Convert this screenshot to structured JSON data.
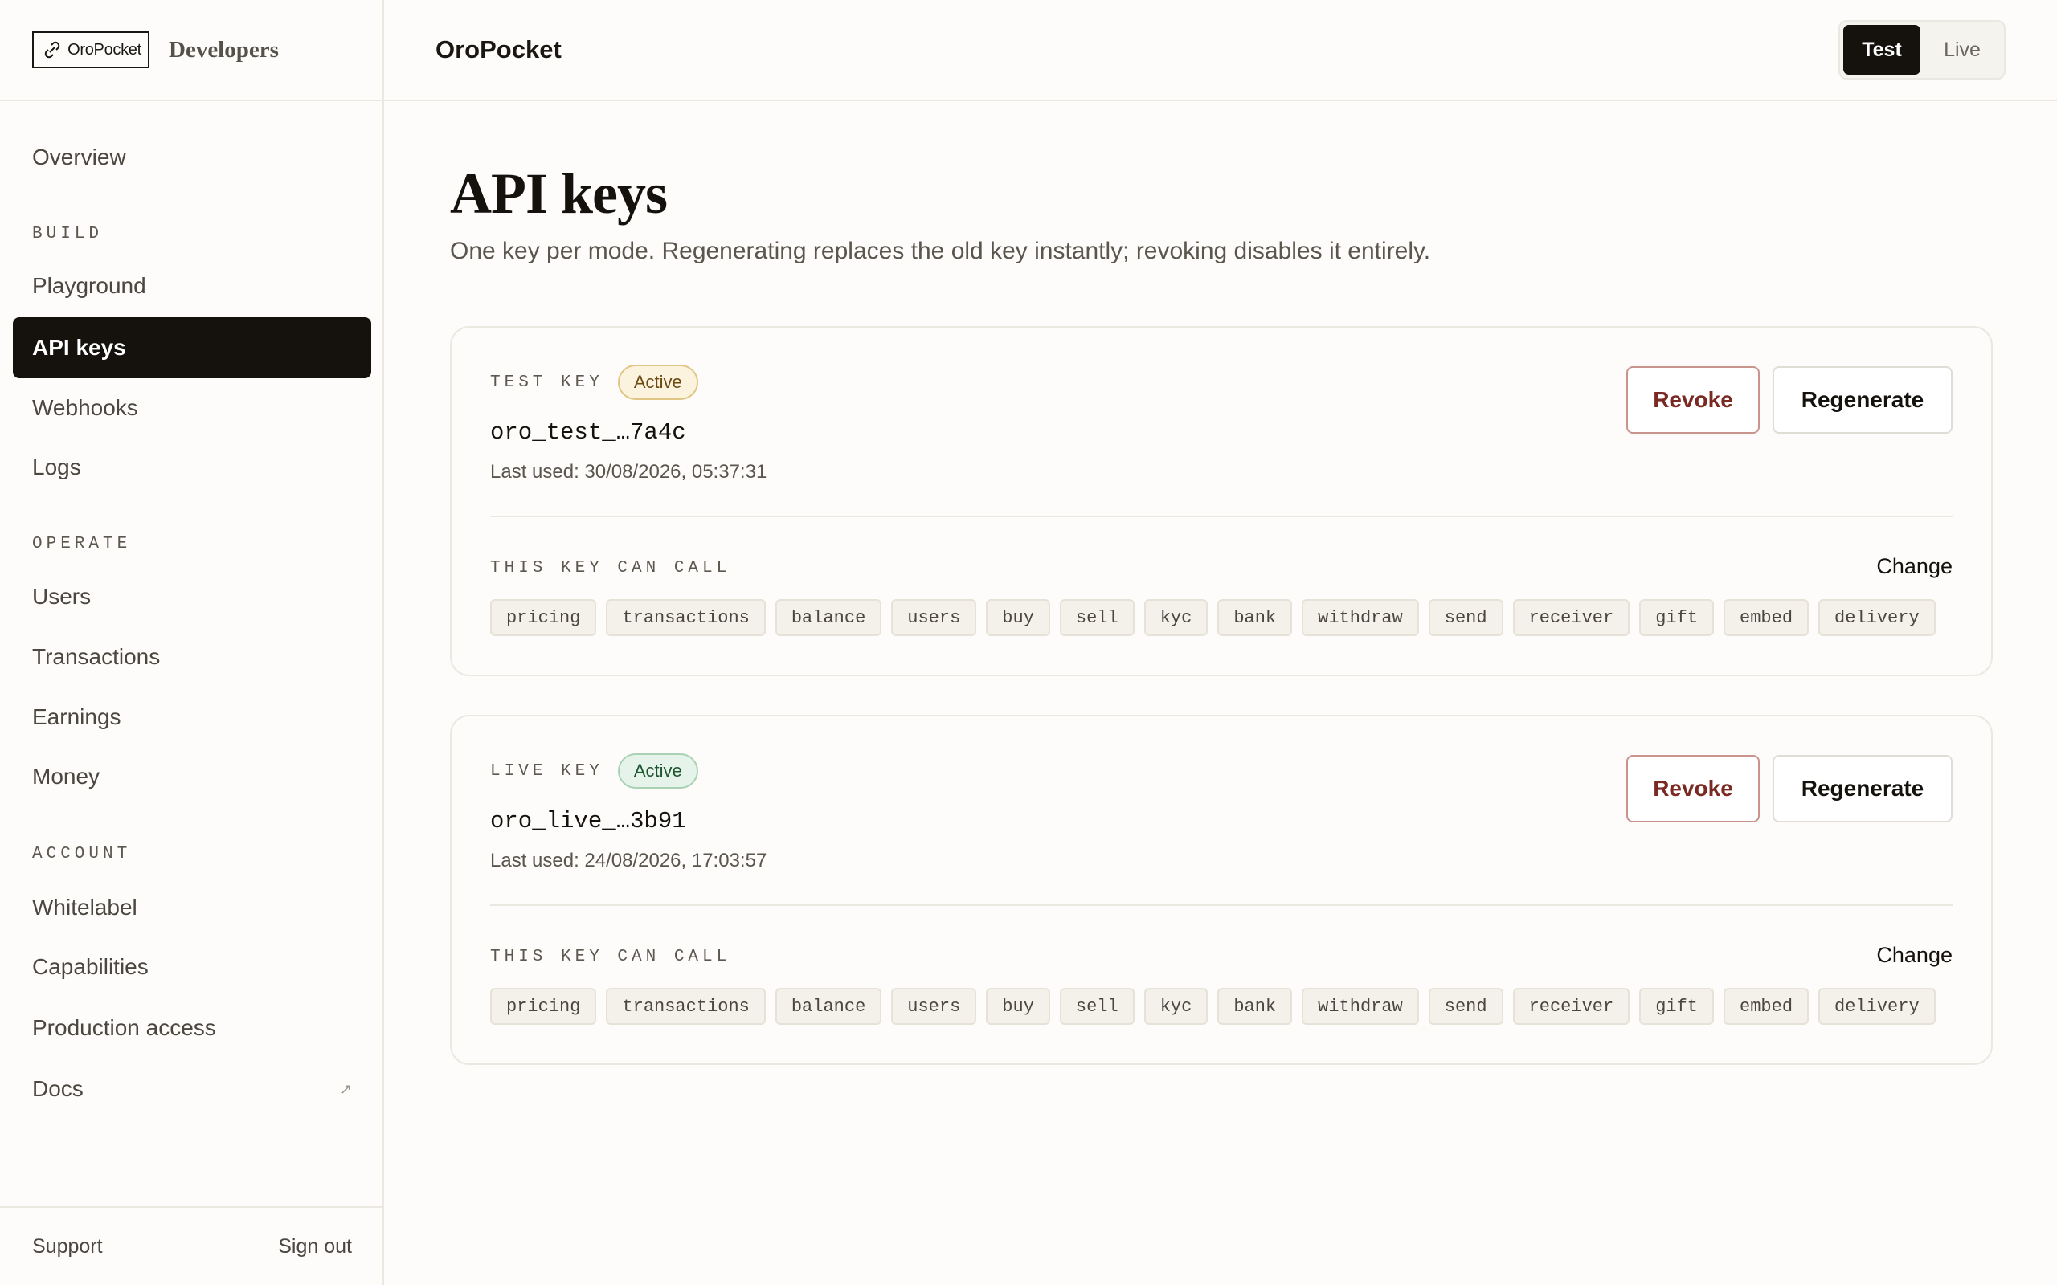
{
  "brand": {
    "logo_text": "OroPocket",
    "subtitle": "Developers"
  },
  "sidebar": {
    "overview": "Overview",
    "sections": {
      "build": "BUILD",
      "operate": "OPERATE",
      "account": "ACCOUNT"
    },
    "build_items": [
      "Playground",
      "API keys",
      "Webhooks",
      "Logs"
    ],
    "operate_items": [
      "Users",
      "Transactions",
      "Earnings",
      "Money"
    ],
    "account_items": [
      "Whitelabel",
      "Capabilities",
      "Production access",
      "Docs"
    ],
    "active_item": "API keys",
    "docs_icon": "external-link-icon",
    "footer": {
      "support": "Support",
      "sign_out": "Sign out"
    }
  },
  "topbar": {
    "title": "OroPocket",
    "modes": [
      "Test",
      "Live"
    ],
    "selected_mode": "Test"
  },
  "page": {
    "title": "API keys",
    "subtitle": "One key per mode. Regenerating replaces the old key instantly; revoking disables it entirely."
  },
  "keys": [
    {
      "label": "TEST KEY",
      "status": "Active",
      "value": "oro_test_…7a4c",
      "last_used": "Last used: 30/08/2026, 05:37:31",
      "revoke_label": "Revoke",
      "regenerate_label": "Regenerate",
      "can_call_label": "THIS KEY CAN CALL",
      "change_label": "Change",
      "scopes": [
        "pricing",
        "transactions",
        "balance",
        "users",
        "buy",
        "sell",
        "kyc",
        "bank",
        "withdraw",
        "send",
        "receiver",
        "gift",
        "embed",
        "delivery"
      ]
    },
    {
      "label": "LIVE KEY",
      "status": "Active",
      "value": "oro_live_…3b91",
      "last_used": "Last used: 24/08/2026, 17:03:57",
      "revoke_label": "Revoke",
      "regenerate_label": "Regenerate",
      "can_call_label": "THIS KEY CAN CALL",
      "change_label": "Change",
      "scopes": [
        "pricing",
        "transactions",
        "balance",
        "users",
        "buy",
        "sell",
        "kyc",
        "bank",
        "withdraw",
        "send",
        "receiver",
        "gift",
        "embed",
        "delivery"
      ]
    }
  ],
  "colors": {
    "accent_dark": "#15120e",
    "revoke_text": "#7a2a22",
    "test_badge_bg": "#fcf3df",
    "live_badge_bg": "#e6f3ea"
  }
}
